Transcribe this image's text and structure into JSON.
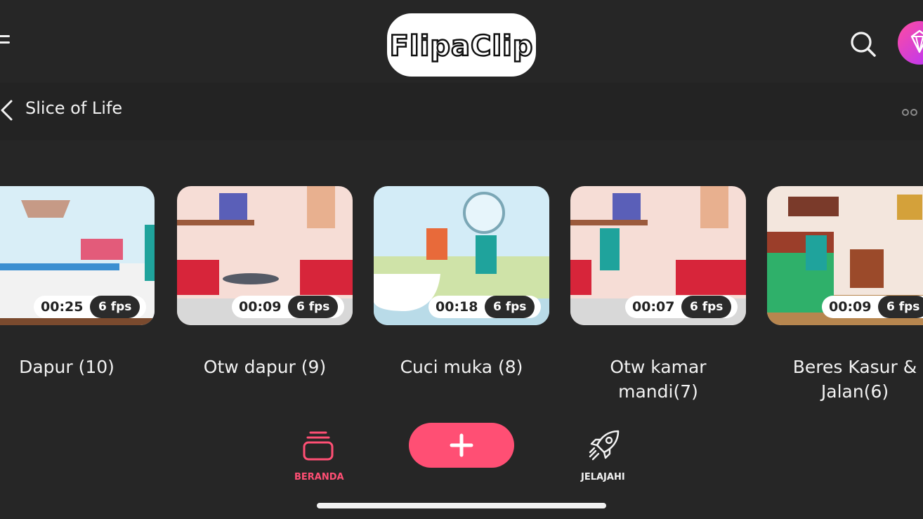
{
  "header": {
    "logo_text": "FlipaClip"
  },
  "subheader": {
    "title": "Slice of Life"
  },
  "projects": [
    {
      "title": "Dapur (10)",
      "duration": "00:25",
      "fps": "6 fps"
    },
    {
      "title": "Otw dapur (9)",
      "duration": "00:09",
      "fps": "6 fps"
    },
    {
      "title": "Cuci muka (8)",
      "duration": "00:18",
      "fps": "6 fps"
    },
    {
      "title": "Otw kamar mandi(7)",
      "duration": "00:07",
      "fps": "6 fps"
    },
    {
      "title": "Beres Kasur & Jalan(6)",
      "duration": "00:09",
      "fps": "6 fps"
    }
  ],
  "nav": {
    "home_label": "BERANDA",
    "explore_label": "JELAJAHI"
  },
  "colors": {
    "accent": "#ff4f74",
    "background": "#262626",
    "premium": "#c83cf0"
  },
  "icons": [
    "menu-icon",
    "search-icon",
    "diamond-icon",
    "back-icon",
    "more-icon",
    "stack-icon",
    "plus-icon",
    "rocket-icon"
  ]
}
